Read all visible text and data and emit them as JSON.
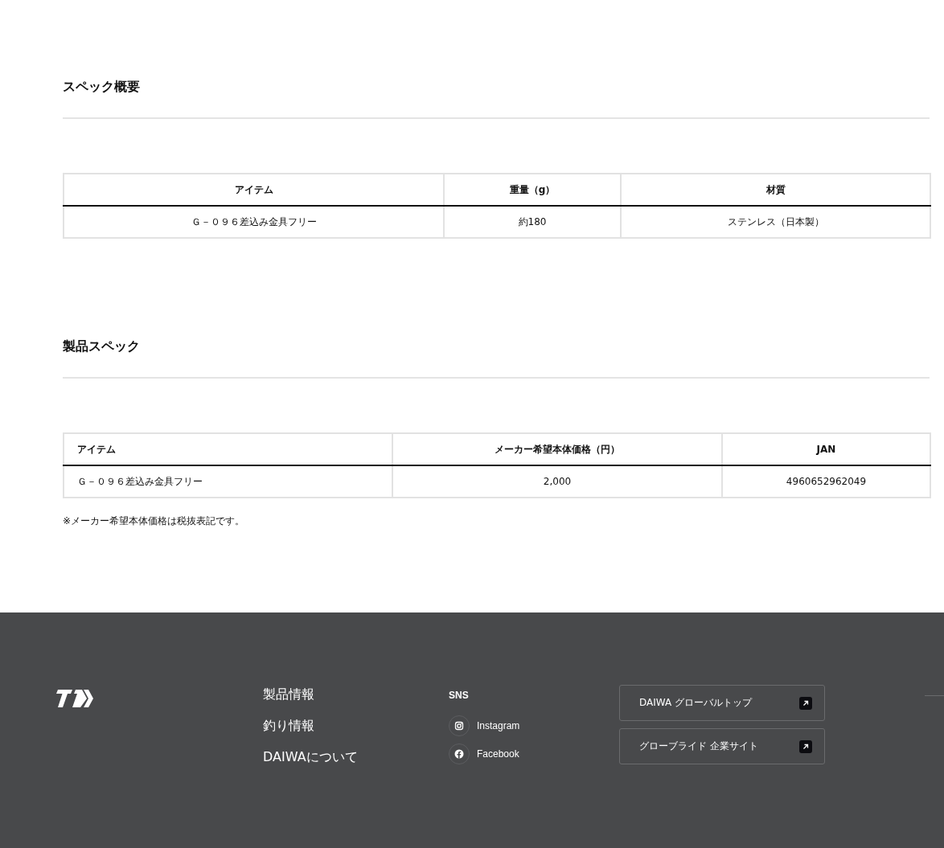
{
  "sections": [
    {
      "title": "スペック概要",
      "table": {
        "kind": "centered",
        "columns": [
          "アイテム",
          "重量（g）",
          "材質"
        ],
        "rows": [
          [
            "Ｇ－０９６差込み金具フリー",
            "約180",
            "ステンレス（日本製）"
          ]
        ]
      }
    },
    {
      "title": "製品スペック",
      "table": {
        "kind": "item-left",
        "columns": [
          "アイテム",
          "メーカー希望本体価格（円）",
          "JAN"
        ],
        "rows": [
          [
            "Ｇ－０９６差込み金具フリー",
            "2,000",
            "4960652962049"
          ]
        ]
      },
      "note": "※メーカー希望本体価格は税抜表記です。"
    }
  ],
  "footer": {
    "nav": [
      "製品情報",
      "釣り情報",
      "DAIWAについて"
    ],
    "sns": {
      "title": "SNS",
      "items": [
        {
          "label": "Instagram",
          "kind": "instagram"
        },
        {
          "label": "Facebook",
          "kind": "facebook"
        }
      ]
    },
    "links": [
      "DAIWA グローバルトップ",
      "グローブライド 企業サイト"
    ]
  }
}
